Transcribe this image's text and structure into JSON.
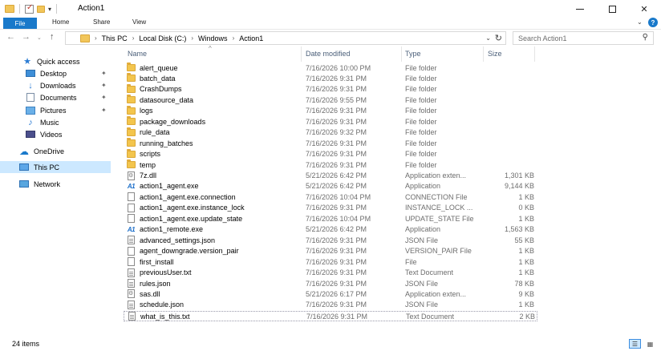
{
  "window": {
    "title": "Action1",
    "minimize_glyph": "—",
    "restore_glyph": "",
    "close_glyph": "✕"
  },
  "ribbon": {
    "tabs": [
      {
        "label": "File"
      },
      {
        "label": "Home"
      },
      {
        "label": "Share"
      },
      {
        "label": "View"
      }
    ],
    "expand_glyph": "⌄",
    "help_glyph": "?"
  },
  "navigation": {
    "back_glyph": "←",
    "forward_glyph": "→",
    "recent_glyph": "⌄",
    "up_glyph": "↑"
  },
  "address": {
    "crumbs": [
      "This PC",
      "Local Disk (C:)",
      "Windows",
      "Action1"
    ],
    "refresh_glyph": "↻"
  },
  "search": {
    "placeholder": "Search Action1",
    "icon": "search-icon"
  },
  "nav_pane": {
    "items": [
      {
        "label": "Quick access",
        "icon": "star-icon",
        "pinned": false
      },
      {
        "label": "Desktop",
        "icon": "desktop-icon",
        "pinned": true
      },
      {
        "label": "Downloads",
        "icon": "download-icon",
        "pinned": true
      },
      {
        "label": "Documents",
        "icon": "documents-icon",
        "pinned": true
      },
      {
        "label": "Pictures",
        "icon": "pictures-icon",
        "pinned": true
      },
      {
        "label": "Music",
        "icon": "music-icon",
        "pinned": false
      },
      {
        "label": "Videos",
        "icon": "videos-icon",
        "pinned": false
      },
      {
        "label": "OneDrive",
        "icon": "cloud-icon",
        "pinned": false
      },
      {
        "label": "This PC",
        "icon": "computer-icon",
        "pinned": false,
        "selected": true
      },
      {
        "label": "Network",
        "icon": "network-icon",
        "pinned": false
      }
    ],
    "pin_glyph": "📌"
  },
  "columns": {
    "name": "Name",
    "date": "Date modified",
    "type": "Type",
    "size": "Size"
  },
  "files": [
    {
      "name": "alert_queue",
      "date": "7/16/2026 10:00 PM",
      "type": "File folder",
      "size": "",
      "icon": "folder"
    },
    {
      "name": "batch_data",
      "date": "7/16/2026 9:31 PM",
      "type": "File folder",
      "size": "",
      "icon": "folder"
    },
    {
      "name": "CrashDumps",
      "date": "7/16/2026 9:31 PM",
      "type": "File folder",
      "size": "",
      "icon": "folder"
    },
    {
      "name": "datasource_data",
      "date": "7/16/2026 9:55 PM",
      "type": "File folder",
      "size": "",
      "icon": "folder"
    },
    {
      "name": "logs",
      "date": "7/16/2026 9:31 PM",
      "type": "File folder",
      "size": "",
      "icon": "folder"
    },
    {
      "name": "package_downloads",
      "date": "7/16/2026 9:31 PM",
      "type": "File folder",
      "size": "",
      "icon": "folder"
    },
    {
      "name": "rule_data",
      "date": "7/16/2026 9:32 PM",
      "type": "File folder",
      "size": "",
      "icon": "folder"
    },
    {
      "name": "running_batches",
      "date": "7/16/2026 9:31 PM",
      "type": "File folder",
      "size": "",
      "icon": "folder"
    },
    {
      "name": "scripts",
      "date": "7/16/2026 9:31 PM",
      "type": "File folder",
      "size": "",
      "icon": "folder"
    },
    {
      "name": "temp",
      "date": "7/16/2026 9:31 PM",
      "type": "File folder",
      "size": "",
      "icon": "folder"
    },
    {
      "name": "7z.dll",
      "date": "5/21/2026 6:42 PM",
      "type": "Application exten...",
      "size": "1,301 KB",
      "icon": "dll"
    },
    {
      "name": "action1_agent.exe",
      "date": "5/21/2026 6:42 PM",
      "type": "Application",
      "size": "9,144 KB",
      "icon": "exe"
    },
    {
      "name": "action1_agent.exe.connection",
      "date": "7/16/2026 10:04 PM",
      "type": "CONNECTION File",
      "size": "1 KB",
      "icon": "file"
    },
    {
      "name": "action1_agent.exe.instance_lock",
      "date": "7/16/2026 9:31 PM",
      "type": "INSTANCE_LOCK ...",
      "size": "0 KB",
      "icon": "file"
    },
    {
      "name": "action1_agent.exe.update_state",
      "date": "7/16/2026 10:04 PM",
      "type": "UPDATE_STATE File",
      "size": "1 KB",
      "icon": "file"
    },
    {
      "name": "action1_remote.exe",
      "date": "5/21/2026 6:42 PM",
      "type": "Application",
      "size": "1,563 KB",
      "icon": "exe"
    },
    {
      "name": "advanced_settings.json",
      "date": "7/16/2026 9:31 PM",
      "type": "JSON File",
      "size": "55 KB",
      "icon": "json"
    },
    {
      "name": "agent_downgrade.version_pair",
      "date": "7/16/2026 9:31 PM",
      "type": "VERSION_PAIR File",
      "size": "1 KB",
      "icon": "file"
    },
    {
      "name": "first_install",
      "date": "7/16/2026 9:31 PM",
      "type": "File",
      "size": "1 KB",
      "icon": "file"
    },
    {
      "name": "previousUser.txt",
      "date": "7/16/2026 9:31 PM",
      "type": "Text Document",
      "size": "1 KB",
      "icon": "txt"
    },
    {
      "name": "rules.json",
      "date": "7/16/2026 9:31 PM",
      "type": "JSON File",
      "size": "78 KB",
      "icon": "json"
    },
    {
      "name": "sas.dll",
      "date": "5/21/2026 6:17 PM",
      "type": "Application exten...",
      "size": "9 KB",
      "icon": "dll"
    },
    {
      "name": "schedule.json",
      "date": "7/16/2026 9:31 PM",
      "type": "JSON File",
      "size": "1 KB",
      "icon": "json"
    },
    {
      "name": "what_is_this.txt",
      "date": "7/16/2026 9:31 PM",
      "type": "Text Document",
      "size": "2 KB",
      "icon": "txt"
    }
  ],
  "status": {
    "item_count": "24 items"
  },
  "exe_badge": "A1",
  "colors": {
    "accent": "#1979ca",
    "selection": "#cce8ff",
    "folder": "#f3c54d"
  }
}
